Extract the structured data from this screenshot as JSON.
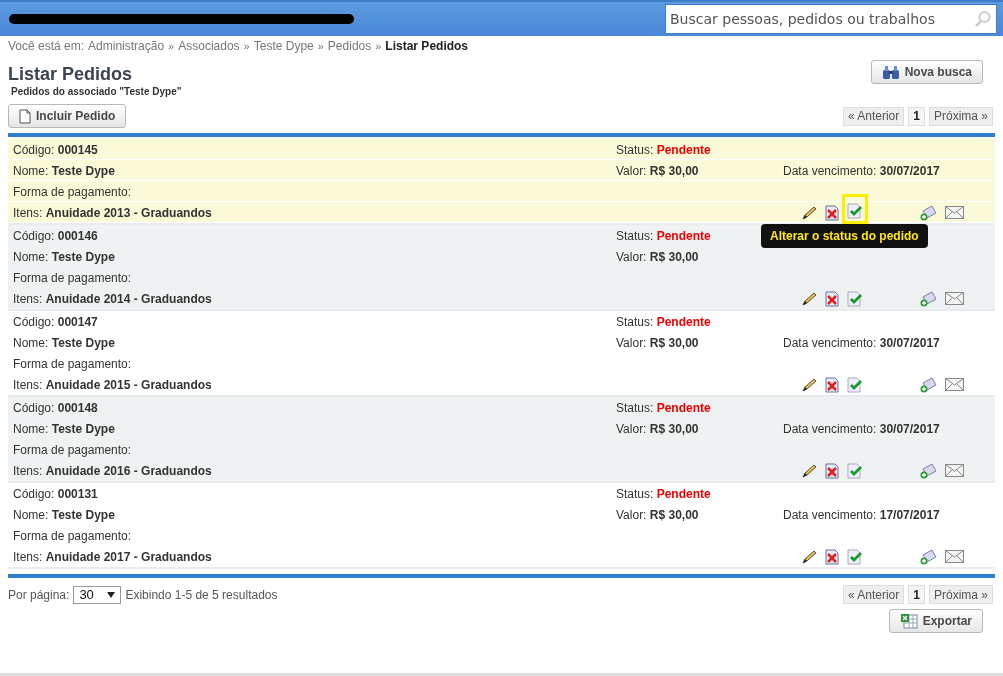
{
  "search": {
    "placeholder": "Buscar pessoas, pedidos ou trabalhos"
  },
  "breadcrumb": {
    "prefix": "Você está em:",
    "links": [
      "Administração",
      "Associados",
      "Teste Dype",
      "Pedidos"
    ],
    "separator": "»",
    "current": "Listar Pedidos"
  },
  "title": "Listar Pedidos",
  "subtitle": "Pedidos do associado \"Teste Dype\"",
  "new_search_button": "Nova busca",
  "add_button": "Incluir Pedido",
  "pagination_top": {
    "prev": "« Anterior",
    "pages": [
      {
        "label": "1",
        "selected": true
      }
    ],
    "next": "Próxima »"
  },
  "rows": [
    {
      "code_label": "Código:",
      "code": "000145",
      "name_label": "Nome:",
      "name": "Teste Dype",
      "payment_label": "Forma de pagamento:",
      "items_label": "Itens:",
      "items": "Anuidade 2013 - Graduandos",
      "status_label": "Status:",
      "status": "Pendente",
      "value_label": "Valor:",
      "value": "R$ 30,00",
      "due_label": "Data vencimento:",
      "due": "30/07/2017",
      "selected": true
    },
    {
      "code_label": "Código:",
      "code": "000146",
      "name_label": "Nome:",
      "name": "Teste Dype",
      "payment_label": "Forma de pagamento:",
      "items_label": "Itens:",
      "items": "Anuidade 2014 - Graduandos",
      "status_label": "Status:",
      "status": "Pendente",
      "value_label": "Valor:",
      "value": "R$ 30,00",
      "selected": false
    },
    {
      "code_label": "Código:",
      "code": "000147",
      "name_label": "Nome:",
      "name": "Teste Dype",
      "payment_label": "Forma de pagamento:",
      "items_label": "Itens:",
      "items": "Anuidade 2015 - Graduandos",
      "status_label": "Status:",
      "status": "Pendente",
      "value_label": "Valor:",
      "value": "R$ 30,00",
      "due_label": "Data vencimento:",
      "due": "30/07/2017",
      "selected": false
    },
    {
      "code_label": "Código:",
      "code": "000148",
      "name_label": "Nome:",
      "name": "Teste Dype",
      "payment_label": "Forma de pagamento:",
      "items_label": "Itens:",
      "items": "Anuidade 2016 - Graduandos",
      "status_label": "Status:",
      "status": "Pendente",
      "value_label": "Valor:",
      "value": "R$ 30,00",
      "due_label": "Data vencimento:",
      "due": "30/07/2017",
      "selected": false
    },
    {
      "code_label": "Código:",
      "code": "000131",
      "name_label": "Nome:",
      "name": "Teste Dype",
      "payment_label": "Forma de pagamento:",
      "items_label": "Itens:",
      "items": "Anuidade 2017 - Graduandos",
      "status_label": "Status:",
      "status": "Pendente",
      "value_label": "Valor:",
      "value": "R$ 30,00",
      "due_label": "Data vencimento:",
      "due": "17/07/2017",
      "selected": false
    }
  ],
  "tooltip": {
    "text": "Alterar o status do pedido"
  },
  "footer": {
    "per_page_label": "Por página:",
    "per_page_value": "30",
    "summary": "Exibindo 1-5 de 5 resultados"
  },
  "pagination_bottom": {
    "prev": "« Anterior",
    "pages": [
      {
        "label": "1",
        "selected": true
      }
    ],
    "next": "Próxima »"
  },
  "export_button": "Exportar"
}
